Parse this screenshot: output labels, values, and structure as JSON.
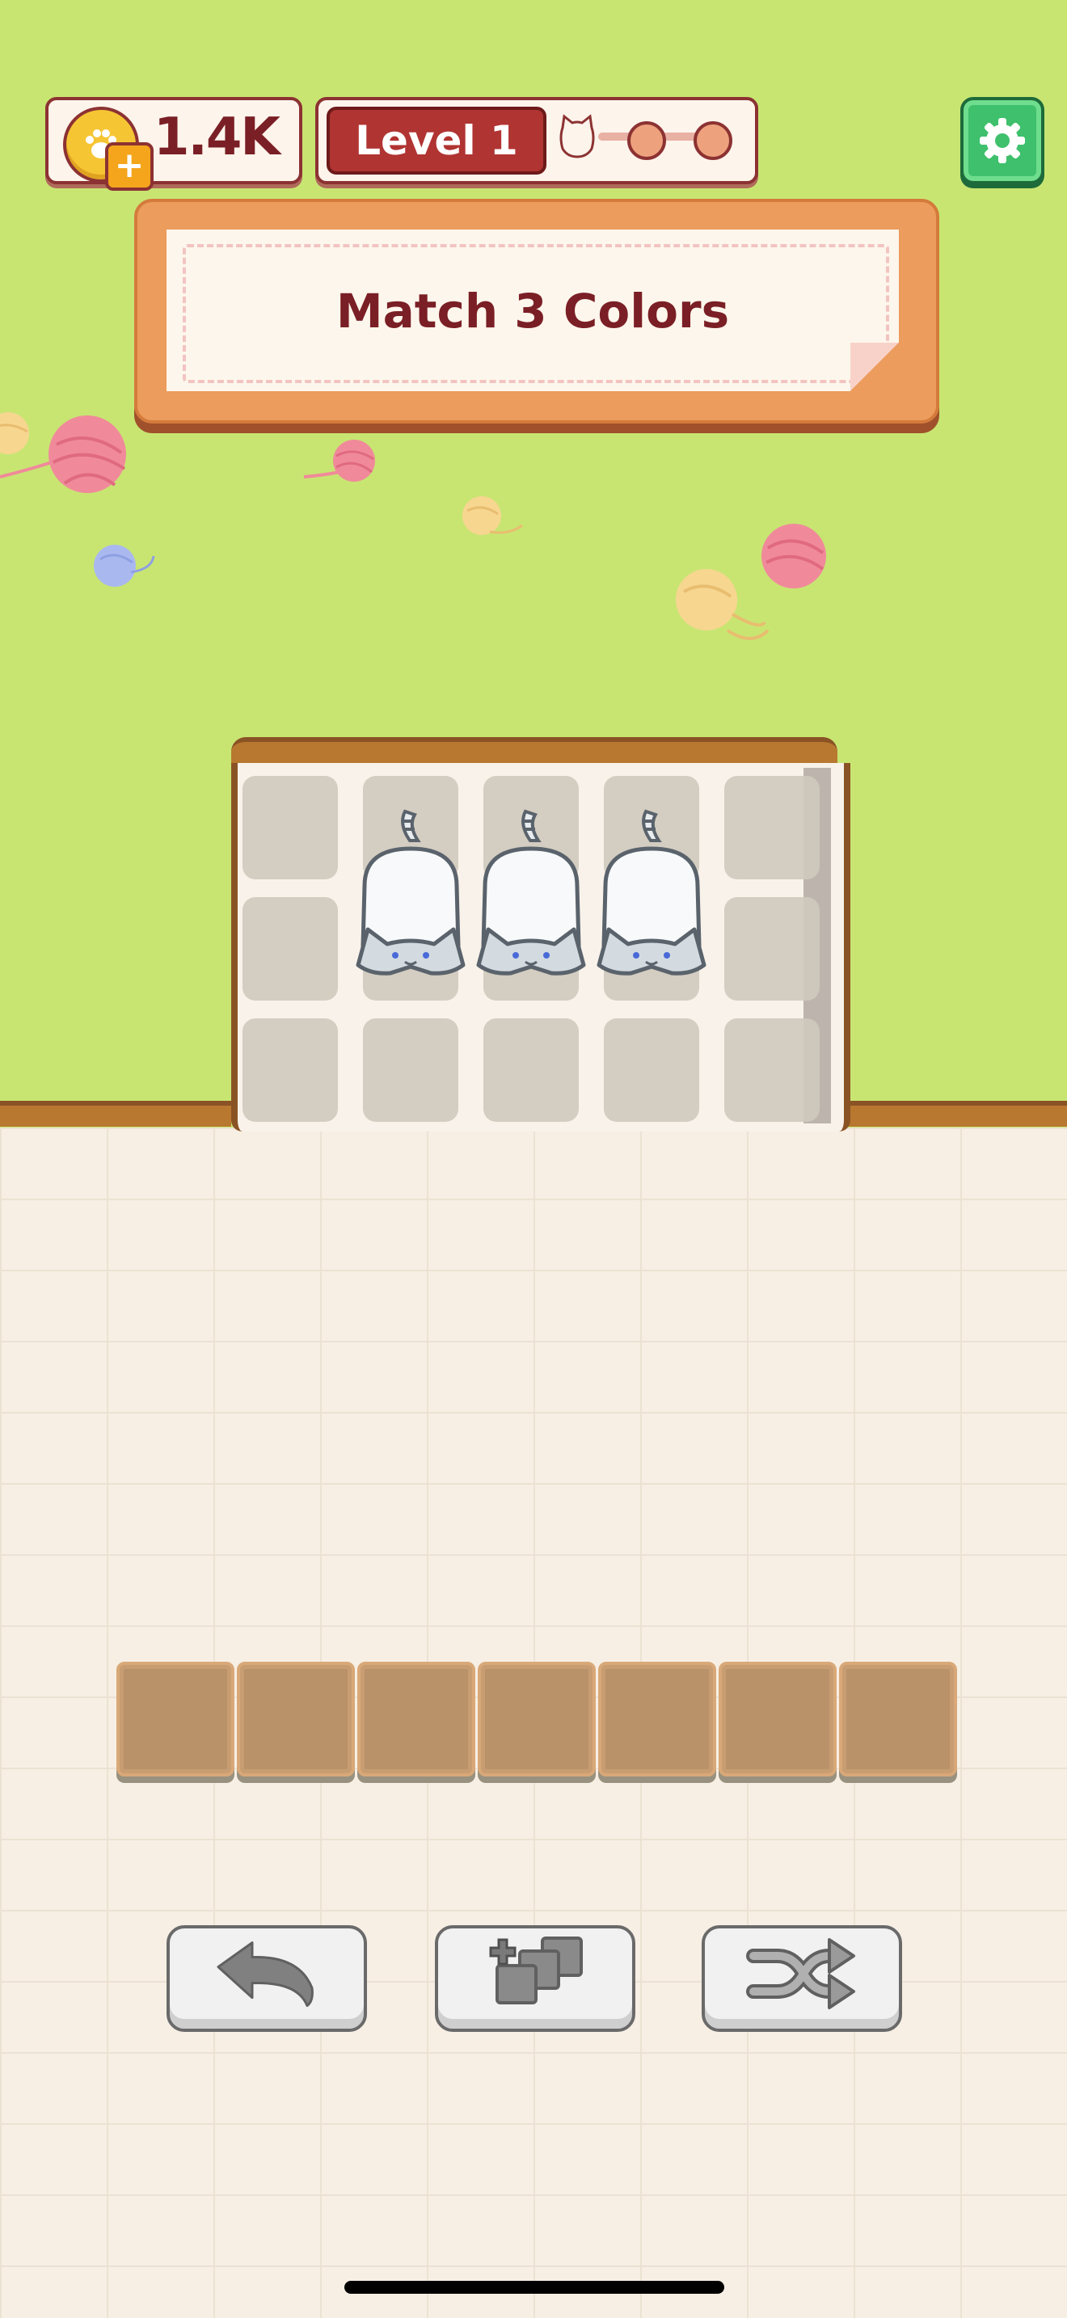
{
  "hud": {
    "coins": "1.4K",
    "coin_plus": "+",
    "level_label": "Level 1",
    "level_progress": {
      "stages": 3,
      "current": 1
    }
  },
  "banner": {
    "text": "Match 3 Colors"
  },
  "board": {
    "rows": 3,
    "columns": 5,
    "cats": [
      {
        "row": 2,
        "col": 2,
        "color": "white"
      },
      {
        "row": 2,
        "col": 3,
        "color": "white"
      },
      {
        "row": 2,
        "col": 4,
        "color": "white"
      }
    ]
  },
  "tray": {
    "slots": 7,
    "filled": 0
  },
  "tools": [
    {
      "id": "undo",
      "icon": "undo-arrow-icon"
    },
    {
      "id": "add-slot",
      "icon": "add-tiles-icon"
    },
    {
      "id": "shuffle",
      "icon": "shuffle-icon"
    }
  ],
  "colors": {
    "lawn": "#c8e572",
    "floor": "#f7efe4",
    "accent_red": "#b03432",
    "banner_orange": "#ec9c5c",
    "settings_green": "#3fc06c",
    "yarn_pink": "#f08a9a",
    "yarn_yellow": "#f7d690",
    "yarn_blue": "#aab8f0"
  }
}
